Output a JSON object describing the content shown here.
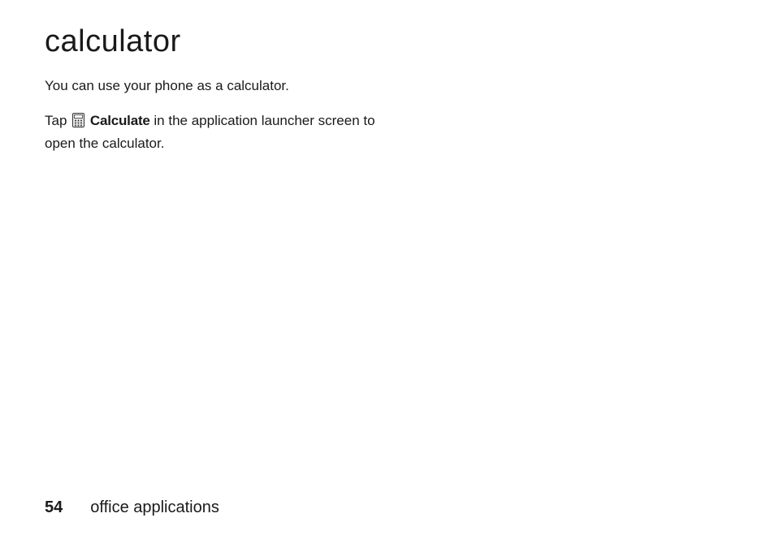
{
  "heading": "calculator",
  "intro": "You can use your phone as a calculator.",
  "instruction": {
    "prefix": "Tap ",
    "icon_name": "calculator-icon",
    "app_label": "Calculate",
    "suffix": " in the application launcher screen to open the calculator."
  },
  "footer": {
    "page_number": "54",
    "section": "office applications"
  }
}
